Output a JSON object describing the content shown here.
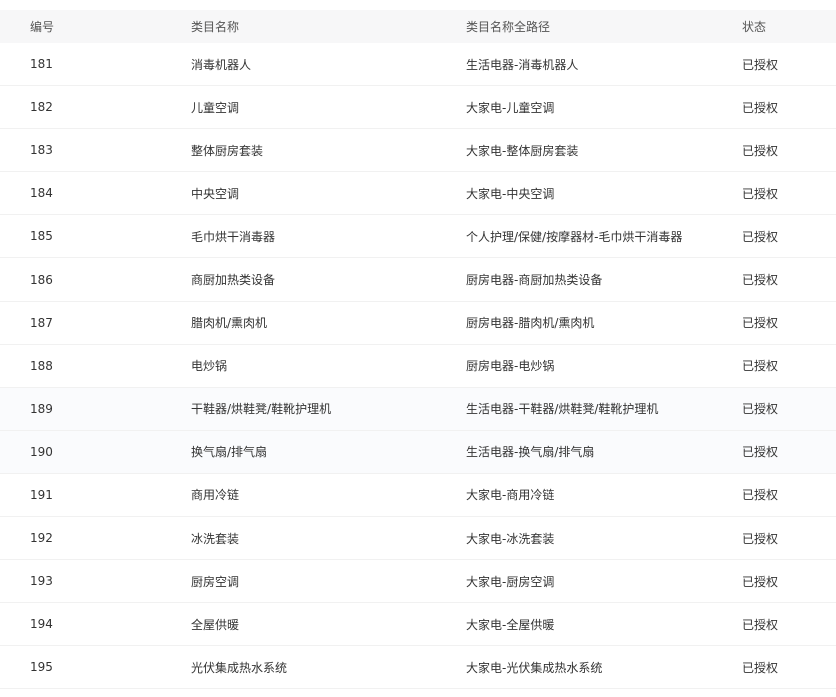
{
  "columns": {
    "id": "编号",
    "name": "类目名称",
    "path": "类目名称全路径",
    "status": "状态"
  },
  "rows": [
    {
      "id": "181",
      "name": "消毒机器人",
      "path": "生活电器-消毒机器人",
      "status": "已授权"
    },
    {
      "id": "182",
      "name": "儿童空调",
      "path": "大家电-儿童空调",
      "status": "已授权"
    },
    {
      "id": "183",
      "name": "整体厨房套装",
      "path": "大家电-整体厨房套装",
      "status": "已授权"
    },
    {
      "id": "184",
      "name": "中央空调",
      "path": "大家电-中央空调",
      "status": "已授权"
    },
    {
      "id": "185",
      "name": "毛巾烘干消毒器",
      "path": "个人护理/保健/按摩器材-毛巾烘干消毒器",
      "status": "已授权"
    },
    {
      "id": "186",
      "name": "商厨加热类设备",
      "path": "厨房电器-商厨加热类设备",
      "status": "已授权"
    },
    {
      "id": "187",
      "name": "腊肉机/熏肉机",
      "path": "厨房电器-腊肉机/熏肉机",
      "status": "已授权"
    },
    {
      "id": "188",
      "name": "电炒锅",
      "path": "厨房电器-电炒锅",
      "status": "已授权"
    },
    {
      "id": "189",
      "name": "干鞋器/烘鞋凳/鞋靴护理机",
      "path": "生活电器-干鞋器/烘鞋凳/鞋靴护理机",
      "status": "已授权"
    },
    {
      "id": "190",
      "name": "换气扇/排气扇",
      "path": "生活电器-换气扇/排气扇",
      "status": "已授权"
    },
    {
      "id": "191",
      "name": "商用冷链",
      "path": "大家电-商用冷链",
      "status": "已授权"
    },
    {
      "id": "192",
      "name": "冰洗套装",
      "path": "大家电-冰洗套装",
      "status": "已授权"
    },
    {
      "id": "193",
      "name": "厨房空调",
      "path": "大家电-厨房空调",
      "status": "已授权"
    },
    {
      "id": "194",
      "name": "全屋供暖",
      "path": "大家电-全屋供暖",
      "status": "已授权"
    },
    {
      "id": "195",
      "name": "光伏集成热水系统",
      "path": "大家电-光伏集成热水系统",
      "status": "已授权"
    }
  ]
}
